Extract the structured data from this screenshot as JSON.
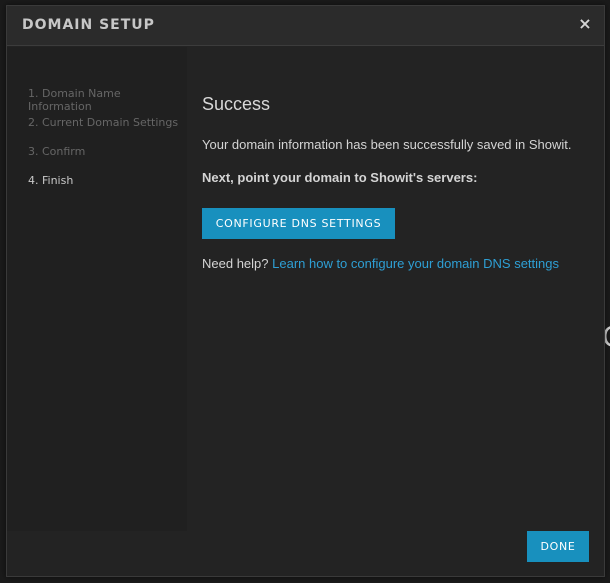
{
  "modal": {
    "title": "DOMAIN SETUP",
    "close_glyph": "×"
  },
  "steps": [
    {
      "label": "1. Domain Name Information",
      "active": false
    },
    {
      "label": "2. Current Domain Settings",
      "active": false
    },
    {
      "label": "3. Confirm",
      "active": false
    },
    {
      "label": "4. Finish",
      "active": true
    }
  ],
  "content": {
    "heading": "Success",
    "saved_message": "Your domain information has been successfully saved in Showit.",
    "next_message": "Next, point your domain to Showit's servers:",
    "dns_button_label": "CONFIGURE DNS SETTINGS",
    "help_prefix": "Need help? ",
    "help_link_text": "Learn how to configure your domain DNS settings"
  },
  "footer": {
    "done_label": "DONE"
  },
  "colors": {
    "accent": "#1890be",
    "link": "#2e9fd4",
    "background": "#232323"
  }
}
